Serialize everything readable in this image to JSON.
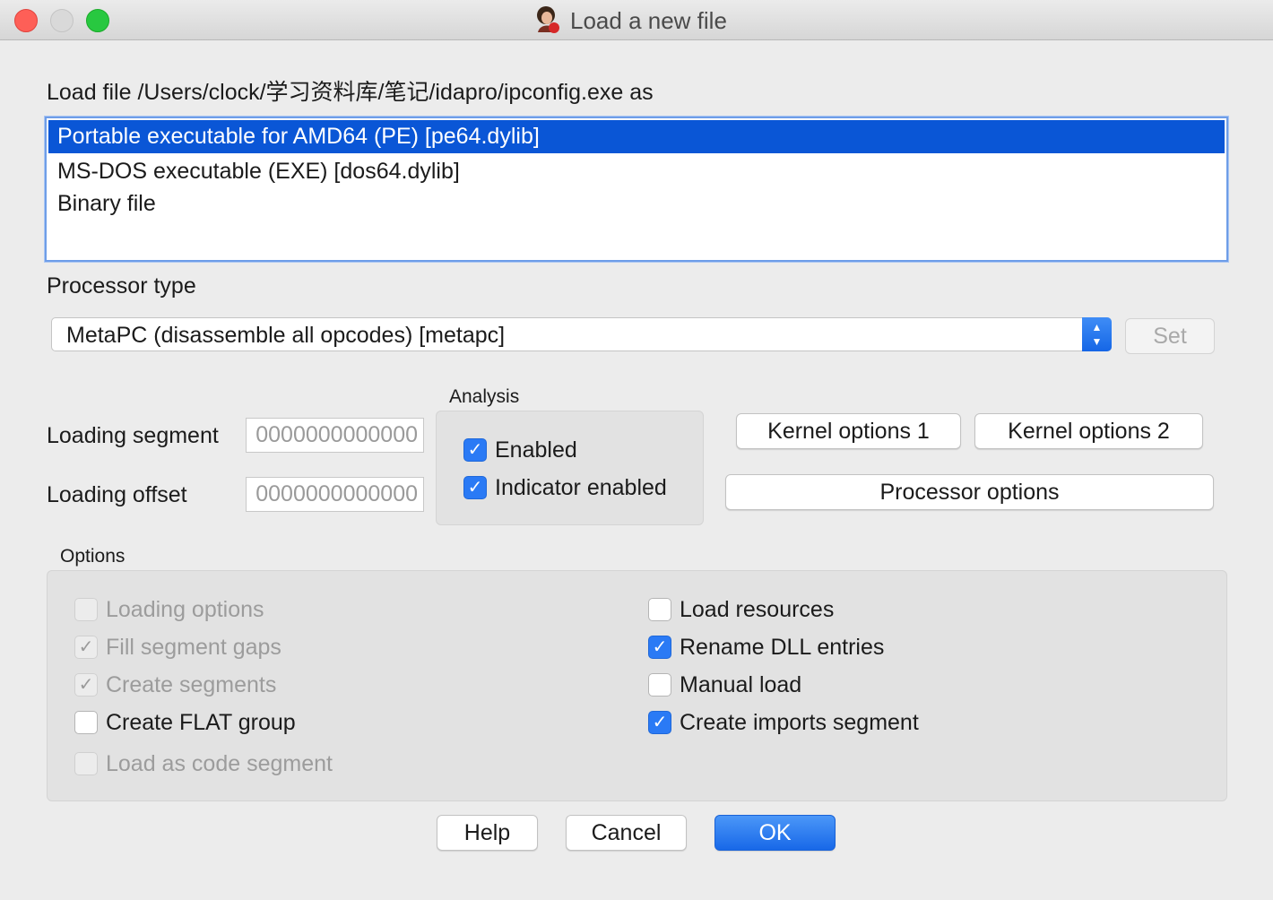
{
  "window": {
    "title": "Load a new file"
  },
  "load_file_label": "Load file /Users/clock/学习资料库/笔记/idapro/ipconfig.exe as",
  "loaders": [
    {
      "label": "Portable executable for AMD64 (PE) [pe64.dylib]",
      "selected": true
    },
    {
      "label": "MS-DOS executable (EXE) [dos64.dylib]",
      "selected": false
    },
    {
      "label": "Binary file",
      "selected": false
    }
  ],
  "processor": {
    "label": "Processor type",
    "selected": "MetaPC (disassemble all opcodes) [metapc]",
    "set_button": "Set"
  },
  "loading": {
    "segment_label": "Loading segment",
    "segment_value": "0000000000000",
    "offset_label": "Loading offset",
    "offset_value": "0000000000000"
  },
  "analysis": {
    "title": "Analysis",
    "enabled": {
      "label": "Enabled",
      "checked": true
    },
    "indicator": {
      "label": "Indicator enabled",
      "checked": true
    }
  },
  "kernel_buttons": {
    "kernel1": "Kernel options 1",
    "kernel2": "Kernel options 2",
    "processor_options": "Processor options"
  },
  "options": {
    "title": "Options",
    "left": [
      {
        "label": "Loading options",
        "checked": false,
        "disabled": true
      },
      {
        "label": "Fill segment gaps",
        "checked": true,
        "disabled": true
      },
      {
        "label": "Create segments",
        "checked": true,
        "disabled": true
      },
      {
        "label": "Create FLAT group",
        "checked": false,
        "disabled": false
      },
      {
        "label": "Load as code segment",
        "checked": false,
        "disabled": true
      }
    ],
    "right": [
      {
        "label": "Load resources",
        "checked": false,
        "disabled": false
      },
      {
        "label": "Rename DLL entries",
        "checked": true,
        "disabled": false
      },
      {
        "label": "Manual load",
        "checked": false,
        "disabled": false
      },
      {
        "label": "Create imports segment",
        "checked": true,
        "disabled": false
      }
    ]
  },
  "footer": {
    "help": "Help",
    "cancel": "Cancel",
    "ok": "OK"
  },
  "colors": {
    "selection": "#0a56d6",
    "accent": "#2a7af5"
  }
}
